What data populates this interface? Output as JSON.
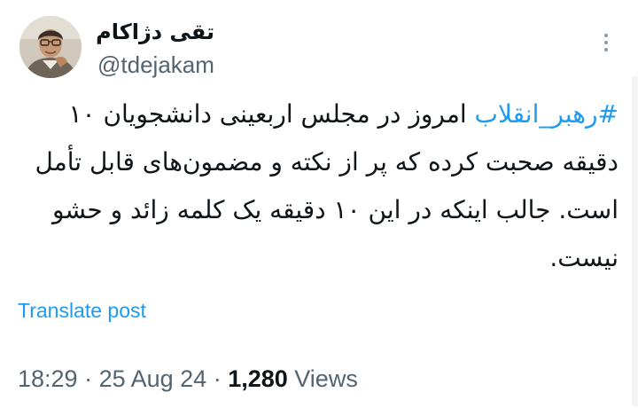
{
  "author": {
    "display_name": "تقی دژاکام",
    "handle": "@tdejakam"
  },
  "menu": {
    "icon": "more-vertical-icon"
  },
  "tweet": {
    "hashtag": "#رهبر_انقلاب",
    "body": " امروز در مجلس اربعینی دانشجویان ۱۰ دقیقه صحبت کرده که پر از نکته و مضمون‌های قابل تأمل است. جالب اینکه در این ۱۰ دقیقه یک کلمه زائد و حشو نیست."
  },
  "translate_label": "Translate post",
  "meta": {
    "time": "18:29",
    "separator": " · ",
    "date": "25 Aug 24",
    "views_count": "1,280",
    "views_label": " Views"
  },
  "colors": {
    "link": "#1d9bf0",
    "text": "#0f1419",
    "secondary": "#536471"
  }
}
